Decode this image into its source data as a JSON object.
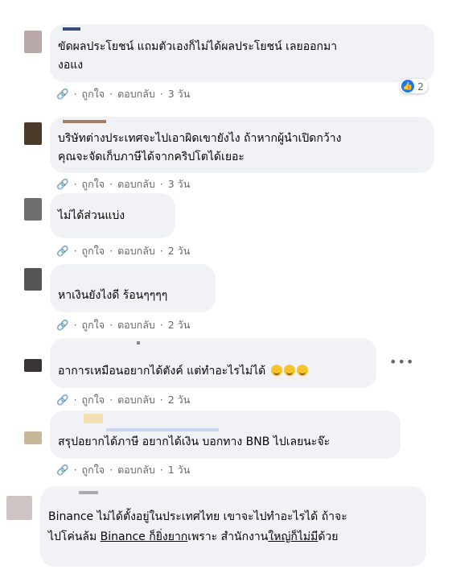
{
  "comments": [
    {
      "text_line1": "ขัดผลประโยชน์ แถมตัวเองก็ไม่ได้ผลประโยชน์ เลยออกมา",
      "text_line2": "งอแง",
      "actions": {
        "like": "ถูกใจ",
        "reply": "ตอบกลับ",
        "time": "3 วัน"
      },
      "reaction_count": "2",
      "avatar_color": "#b9a9a9"
    },
    {
      "text_line1": "บริษัทต่างประเทศจะไปเอาผิดเขายังไง ถ้าหากผู้นำเปิดกว้าง",
      "text_line2": "คุณจะจัดเก็บภาษีได้จากคริปโตได้เยอะ",
      "actions": {
        "like": "ถูกใจ",
        "reply": "ตอบกลับ",
        "time": "3 วัน"
      },
      "avatar_color": "#4a3a2a"
    },
    {
      "text_line1": "ไม่ได้ส่วนแบ่ง",
      "actions": {
        "like": "ถูกใจ",
        "reply": "ตอบกลับ",
        "time": "2 วัน"
      },
      "avatar_color": "#6f6f6f"
    },
    {
      "text_line1": "หาเงินยังไงดี ร้อนๆๆๆๆ",
      "actions": {
        "like": "ถูกใจ",
        "reply": "ตอบกลับ",
        "time": "2 วัน"
      },
      "avatar_color": "#555555"
    },
    {
      "text_line1": "อาการเหมือนอยากได้ตังค์ แต่ทำอะไรไม่ได้",
      "actions": {
        "like": "ถูกใจ",
        "reply": "ตอบกลับ",
        "time": "2 วัน"
      },
      "more_label": "•••",
      "avatar_color": "#3a3535"
    },
    {
      "text_line1": "สรุปอยากได้ภาษี อยากได้เงิน บอกทาง BNB ไปเลยนะจ๊ะ",
      "actions": {
        "like": "ถูกใจ",
        "reply": "ตอบกลับ",
        "time": "1 วัน"
      },
      "avatar_color": "#c8b89a"
    },
    {
      "text_line1a": "Binance ไม่ได้ตั้งอยู่ในประเทศไทย เขาจะไปทำอะไรได้ ถ้าจะ",
      "text_line2a": "ไปโค่นล้ม ",
      "text_line2b": "Binance ก็ยิ่งยาก",
      "text_line2c": "เพราะ สำนักงาน",
      "text_line2d": "ใหญ่ก็ไม่มี",
      "text_line2e": "ด้วย",
      "avatar_color": "#cfc5c5"
    }
  ],
  "colors": {
    "bubble": "#f0f2f5",
    "secondary_text": "#65676b",
    "like_blue": "#1877f2"
  },
  "icons": [
    "like-thumb-icon",
    "smile-emoji-icon",
    "more-dots-icon"
  ]
}
